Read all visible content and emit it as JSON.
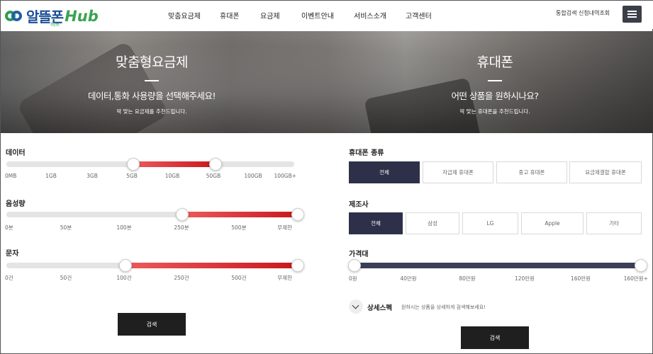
{
  "header": {
    "logo_text": "알뜰폰",
    "logo_hub": "Hub",
    "logo_sub": "허브",
    "nav": [
      "맞춤요금제",
      "휴대폰",
      "요금제",
      "이벤트안내",
      "서비스소개",
      "고객센터"
    ],
    "util_search": "통합검색",
    "util_history": "신청내역조회",
    "menu_icon": "hamburger-icon"
  },
  "hero": {
    "left": {
      "title": "맞춤형요금제",
      "subtitle": "데이터,통화 사용량을 선택해주세요!",
      "note": "딱 맞는 요금제를 추천드립니다."
    },
    "right": {
      "title": "휴대폰",
      "subtitle": "어떤 상품을 원하시나요?",
      "note": "딱 맞는 휴대폰을 추천드립니다."
    }
  },
  "plan": {
    "data": {
      "label": "데이터",
      "ticks": [
        "0MB",
        "1GB",
        "3GB",
        "5GB",
        "10GB",
        "50GB",
        "100GB",
        "100GB+"
      ],
      "range": [
        "5GB",
        "50GB"
      ]
    },
    "voice": {
      "label": "음성량",
      "ticks": [
        "0분",
        "50분",
        "100분",
        "250분",
        "500분",
        "무제한"
      ],
      "range": [
        "250분",
        "무제한"
      ]
    },
    "sms": {
      "label": "문자",
      "ticks": [
        "0건",
        "50건",
        "100건",
        "250건",
        "500건",
        "무제한"
      ],
      "range": [
        "100건",
        "무제한"
      ]
    },
    "search_label": "검색"
  },
  "phone": {
    "type": {
      "label": "휴대폰 종류",
      "options": [
        "전체",
        "자급제 휴대폰",
        "중고 휴대폰",
        "요금제결합 휴대폰"
      ],
      "selected": "전체"
    },
    "maker": {
      "label": "제조사",
      "options": [
        "전체",
        "삼성",
        "LG",
        "Apple",
        "기타"
      ],
      "selected": "전체"
    },
    "price": {
      "label": "가격대",
      "ticks": [
        "0원",
        "40만원",
        "80만원",
        "120만원",
        "160만원",
        "160만원+"
      ],
      "range": [
        "0원",
        "160만원+"
      ]
    },
    "detail": {
      "label": "상세스펙",
      "hint": "원하시는 상품을 상세하게 검색해보세요!"
    },
    "search_label": "검색"
  },
  "colors": {
    "accent_red": "#d42027",
    "navy": "#2d3048",
    "button_dark": "#1f1f1f"
  }
}
